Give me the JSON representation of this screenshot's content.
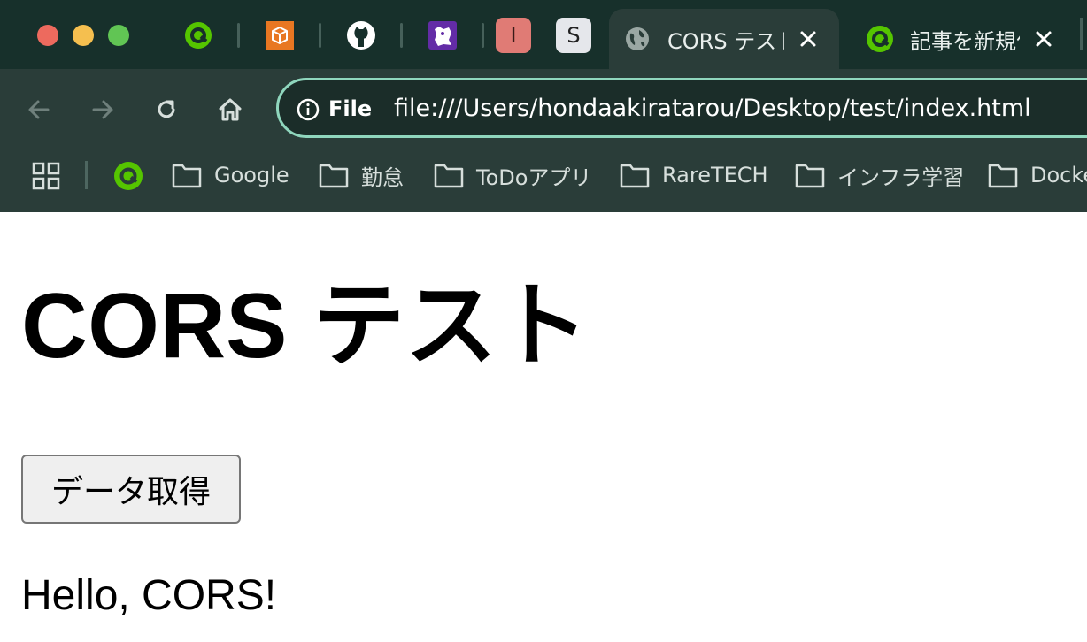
{
  "window": {
    "traffic_lights": {
      "close": "#ed6a5e",
      "minimize": "#f5bf4f",
      "maximize": "#61c554"
    }
  },
  "tabs": {
    "pinned": [
      {
        "name": "qiita-favicon",
        "color": "#55c500"
      },
      {
        "name": "orange-cube-favicon",
        "color": "#e87722"
      },
      {
        "name": "github-favicon",
        "color": "#ffffff"
      },
      {
        "name": "purple-dog-favicon",
        "color": "#632ca6"
      },
      {
        "name": "letter-i-favicon",
        "letter": "I",
        "color": "#e07b75"
      },
      {
        "name": "letter-s-favicon",
        "letter": "S",
        "color": "#e5e7eb"
      }
    ],
    "active": {
      "title": "CORS テスト"
    },
    "inactive": {
      "title": "記事を新規作成"
    }
  },
  "toolbar": {
    "omnibox_label": "File",
    "url": "file:///Users/hondaakiratarou/Desktop/test/index.html",
    "accent": "#8fd6bd"
  },
  "bookmarks": [
    {
      "label": "Google"
    },
    {
      "label": "勤怠"
    },
    {
      "label": "ToDoアプリ"
    },
    {
      "label": "RareTECH"
    },
    {
      "label": "インフラ学習"
    },
    {
      "label": "Docker"
    }
  ],
  "page": {
    "heading": "CORS テスト",
    "button_label": "データ取得",
    "result_text": "Hello, CORS!"
  }
}
